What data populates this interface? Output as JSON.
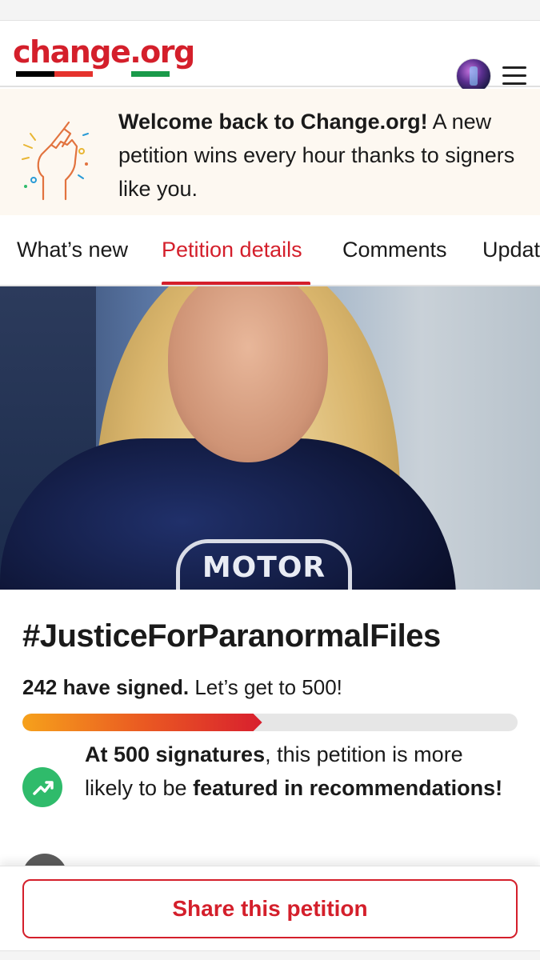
{
  "header": {
    "logo_text": "change.org",
    "logo_underline_colors": [
      "#000000",
      "#e5322d",
      "#ffffff",
      "#1a9a4a"
    ],
    "avatar_icon": "user-avatar",
    "menu_icon": "hamburger-menu-icon"
  },
  "banner": {
    "icon": "raised-fist-icon",
    "bold": "Welcome back to Change.org!",
    "text": " A new petition wins every hour thanks to signers like you."
  },
  "tabs": {
    "items": [
      {
        "label": "What’s new"
      },
      {
        "label": "Petition details",
        "active": true
      },
      {
        "label": "Comments"
      },
      {
        "label": "Updat"
      }
    ]
  },
  "hero": {
    "shirt_text": "MOTOR"
  },
  "petition": {
    "title": "#JusticeForParanormalFiles",
    "signed_bold": "242 have signed.",
    "signed_rest": " Let’s get to 500!",
    "signed_count": 242,
    "goal": 500,
    "progress_fraction": 0.484,
    "milestone_bold1": "At 500 signatures",
    "milestone_text1": ", this petition is more likely to be ",
    "milestone_bold2": "featured in recommendations!",
    "milestone_icon": "trending-up-icon"
  },
  "share": {
    "label": "Share this petition"
  },
  "colors": {
    "brand_red": "#d41f2b",
    "success_green": "#2fbb6b",
    "progress_start": "#f6a11b",
    "progress_end": "#d81f2e",
    "banner_bg": "#fdf8f1"
  }
}
